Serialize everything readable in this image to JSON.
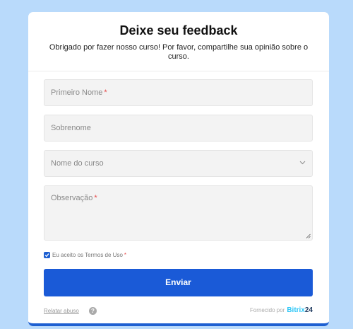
{
  "form": {
    "title": "Deixe seu feedback",
    "subtitle": "Obrigado por fazer nosso curso! Por favor, compartilhe sua opinião sobre o curso.",
    "first_name": {
      "placeholder": "Primeiro Nome",
      "required_mark": "*"
    },
    "last_name": {
      "placeholder": "Sobrenome"
    },
    "course": {
      "placeholder": "Nome do curso"
    },
    "note": {
      "placeholder": "Observação",
      "required_mark": "*"
    },
    "consent": {
      "label": "Eu aceito os Termos de Uso",
      "required_mark": "*",
      "checked": true
    },
    "submit_label": "Enviar"
  },
  "footer": {
    "report_label": "Relatar abuso",
    "help_icon": "?",
    "powered_label": "Fornecido por",
    "brand_part1": "Bitrix",
    "brand_part2": "24"
  },
  "colors": {
    "background": "#b9dafb",
    "accent": "#1a5ad7",
    "required": "#e64a4a",
    "brand_light": "#2fc7f7",
    "brand_dark": "#1f3a5f"
  }
}
